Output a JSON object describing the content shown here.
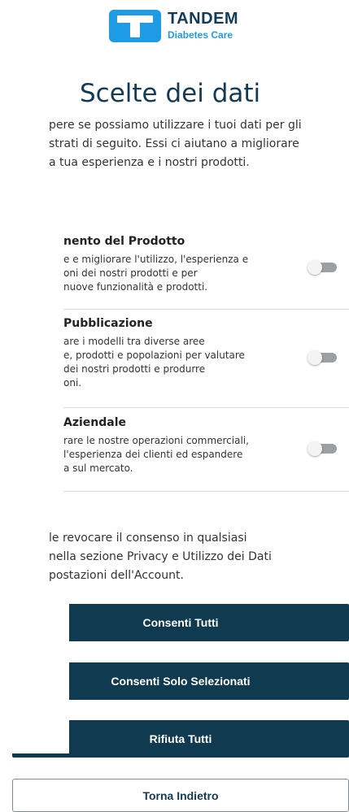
{
  "brand": {
    "name": "TANDEM",
    "subtitle": "Diabetes Care",
    "logo_color": "#1e9be4"
  },
  "title": "Scelte dei dati",
  "intro_lines": [
    "pere se possiamo utilizzare i tuoi dati per gli",
    "strati di seguito. Essi ci aiutano a migliorare",
    "a tua esperienza e i nostri prodotti."
  ],
  "sections": [
    {
      "title": "nento del Prodotto",
      "desc_lines": [
        "e e migliorare l'utilizzo, l'esperienza e",
        "oni dei nostri prodotti e per",
        "nuove funzionalità e prodotti."
      ],
      "enabled": false
    },
    {
      "title": "Pubblicazione",
      "desc_lines": [
        "are i modelli tra diverse aree",
        "e, prodotti e popolazioni per valutare",
        "dei nostri prodotti e produrre",
        "oni."
      ],
      "enabled": false
    },
    {
      "title": "Aziendale",
      "desc_lines": [
        "rare le nostre operazioni commerciali,",
        "l'esperienza dei clienti ed espandere",
        "a sul mercato."
      ],
      "enabled": false
    }
  ],
  "revoke_lines": [
    "le revocare il consenso in qualsiasi",
    "nella sezione Privacy e Utilizzo dei Dati",
    "postazioni dell'Account."
  ],
  "buttons": {
    "accept_all": "Consenti Tutti",
    "accept_selected": "Consenti Solo Selezionati",
    "reject_all": "Rifiuta Tutti",
    "back": "Torna Indietro"
  },
  "colors": {
    "primary_dark": "#0f3a4f",
    "toggle_off": "#9aa0a3"
  }
}
